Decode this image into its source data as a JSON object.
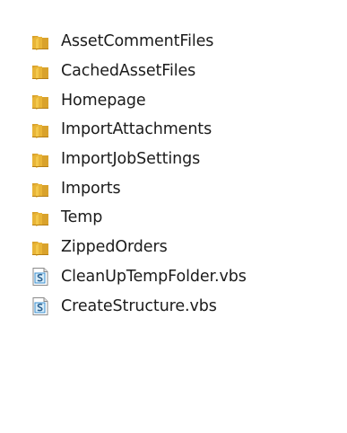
{
  "explorer": {
    "items": [
      {
        "label": "AssetCommentFiles",
        "icon": "folder-icon"
      },
      {
        "label": "CachedAssetFiles",
        "icon": "folder-icon"
      },
      {
        "label": "Homepage",
        "icon": "folder-icon"
      },
      {
        "label": "ImportAttachments",
        "icon": "folder-icon"
      },
      {
        "label": "ImportJobSettings",
        "icon": "folder-icon"
      },
      {
        "label": "Imports",
        "icon": "folder-icon"
      },
      {
        "label": "Temp",
        "icon": "folder-icon"
      },
      {
        "label": "ZippedOrders",
        "icon": "folder-icon"
      },
      {
        "label": "CleanUpTempFolder.vbs",
        "icon": "vbs-script-icon"
      },
      {
        "label": "CreateStructure.vbs",
        "icon": "vbs-script-icon"
      }
    ]
  },
  "colors": {
    "folder_front": "#f3c84b",
    "folder_back": "#d9a22c",
    "folder_shadow": "#b67f16",
    "script_accent": "#3a8fd0"
  }
}
